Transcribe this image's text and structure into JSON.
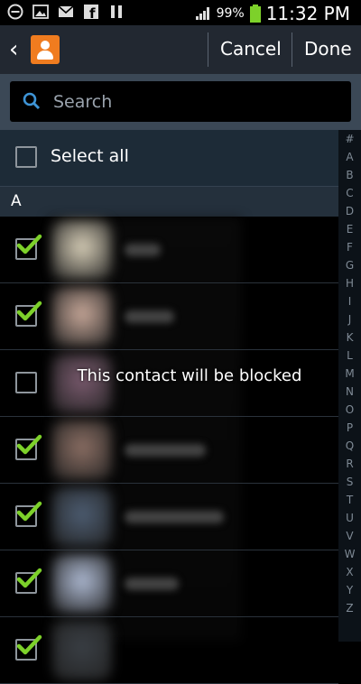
{
  "status_bar": {
    "battery": "99%",
    "time": "11:32 PM"
  },
  "action_bar": {
    "cancel_label": "Cancel",
    "done_label": "Done"
  },
  "search": {
    "placeholder": "Search"
  },
  "select_all": {
    "label": "Select all",
    "checked": false
  },
  "section_header": "A",
  "contacts": [
    {
      "checked": true,
      "photo_color": "#d8cfb8"
    },
    {
      "checked": true,
      "photo_color": "#c9a99a"
    },
    {
      "checked": false,
      "photo_color": "#7a5a6e"
    },
    {
      "checked": true,
      "photo_color": "#8c6f64"
    },
    {
      "checked": true,
      "photo_color": "#4d5d72"
    },
    {
      "checked": true,
      "photo_color": "#aebad3"
    },
    {
      "checked": true,
      "photo_color": "#3a3f45"
    }
  ],
  "toast": {
    "text": "This contact will be blocked"
  },
  "index_letters": [
    "#",
    "A",
    "B",
    "C",
    "D",
    "E",
    "F",
    "G",
    "H",
    "I",
    "J",
    "K",
    "L",
    "M",
    "N",
    "O",
    "P",
    "Q",
    "R",
    "S",
    "T",
    "U",
    "V",
    "W",
    "X",
    "Y",
    "Z"
  ],
  "colors": {
    "accent_check": "#7dd12a",
    "contact_icon": "#f07c1f",
    "search_icon": "#3e94d6"
  }
}
